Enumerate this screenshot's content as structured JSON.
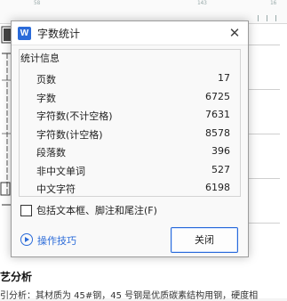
{
  "dialog": {
    "title": "字数统计",
    "app_icon_letter": "W",
    "close_symbol": "✕",
    "group_title": "统计信息",
    "stats": [
      {
        "label": "页数",
        "value": "17"
      },
      {
        "label": "字数",
        "value": "6725"
      },
      {
        "label": "字符数(不计空格)",
        "value": "7631"
      },
      {
        "label": "字符数(计空格)",
        "value": "8578"
      },
      {
        "label": "段落数",
        "value": "396"
      },
      {
        "label": "非中文单词",
        "value": "527"
      },
      {
        "label": "中文字符",
        "value": "6198"
      }
    ],
    "include_textboxes_label": "包括文本框、脚注和尾注(F)",
    "include_textboxes_checked": false,
    "help_link_label": "操作技巧",
    "close_button_label": "关闭"
  },
  "background": {
    "ruler_marks": [
      "58",
      "143",
      "16"
    ],
    "heading": "艺分析",
    "body_line": "引分析：其材质为 45#钢，45 号钢是优质碳素结构用钢，硬度相"
  },
  "colors": {
    "accent": "#2b6bd9"
  }
}
